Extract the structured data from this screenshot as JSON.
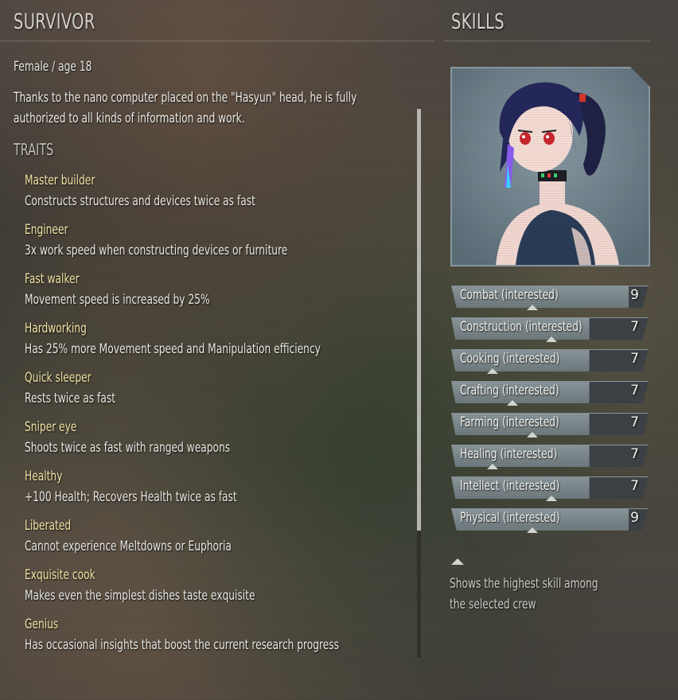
{
  "survivor": {
    "header": "SURVIVOR",
    "gender_age": "Female / age 18",
    "description_line1": "Thanks to the nano computer placed on the \"Hasyun\" head, he is fully",
    "description_line2": "authorized to all kinds of information and work.",
    "traits_title": "TRAITS",
    "traits": [
      {
        "name": "Master builder",
        "desc": "Constructs structures and devices twice as fast"
      },
      {
        "name": "Engineer",
        "desc": "3x work speed when constructing devices or furniture"
      },
      {
        "name": "Fast walker",
        "desc": "Movement speed is increased by 25%"
      },
      {
        "name": "Hardworking",
        "desc": "Has 25% more Movement speed and Manipulation efficiency"
      },
      {
        "name": "Quick sleeper",
        "desc": "Rests twice as fast"
      },
      {
        "name": "Sniper eye",
        "desc": "Shoots twice as fast with ranged weapons"
      },
      {
        "name": "Healthy",
        "desc": "+100 Health; Recovers Health twice as fast"
      },
      {
        "name": "Liberated",
        "desc": "Cannot experience Meltdowns or Euphoria"
      },
      {
        "name": "Exquisite cook",
        "desc": "Makes even the simplest dishes taste exquisite"
      },
      {
        "name": "Genius",
        "desc": "Has occasional insights that boost the current research progress"
      }
    ]
  },
  "skills": {
    "header": "SKILLS",
    "max": 10,
    "items": [
      {
        "label": "Combat (interested)",
        "value": 9,
        "marker": 0.41
      },
      {
        "label": "Construction (interested)",
        "value": 7,
        "marker": 0.51
      },
      {
        "label": "Cooking (interested)",
        "value": 7,
        "marker": 0.21
      },
      {
        "label": "Crafting (interested)",
        "value": 7,
        "marker": 0.31
      },
      {
        "label": "Farming (interested)",
        "value": 7,
        "marker": 0.41
      },
      {
        "label": "Healing (interested)",
        "value": 7,
        "marker": 0.21
      },
      {
        "label": "Intellect (interested)",
        "value": 7,
        "marker": 0.51
      },
      {
        "label": "Physical (interested)",
        "value": 9,
        "marker": 0.41
      }
    ],
    "legend_line1": "Shows the highest skill among",
    "legend_line2": "the selected crew"
  },
  "colors": {
    "trait_name": "#f4e7a6",
    "skill_fill": "#8b979b",
    "skill_track": "#3c4245"
  }
}
